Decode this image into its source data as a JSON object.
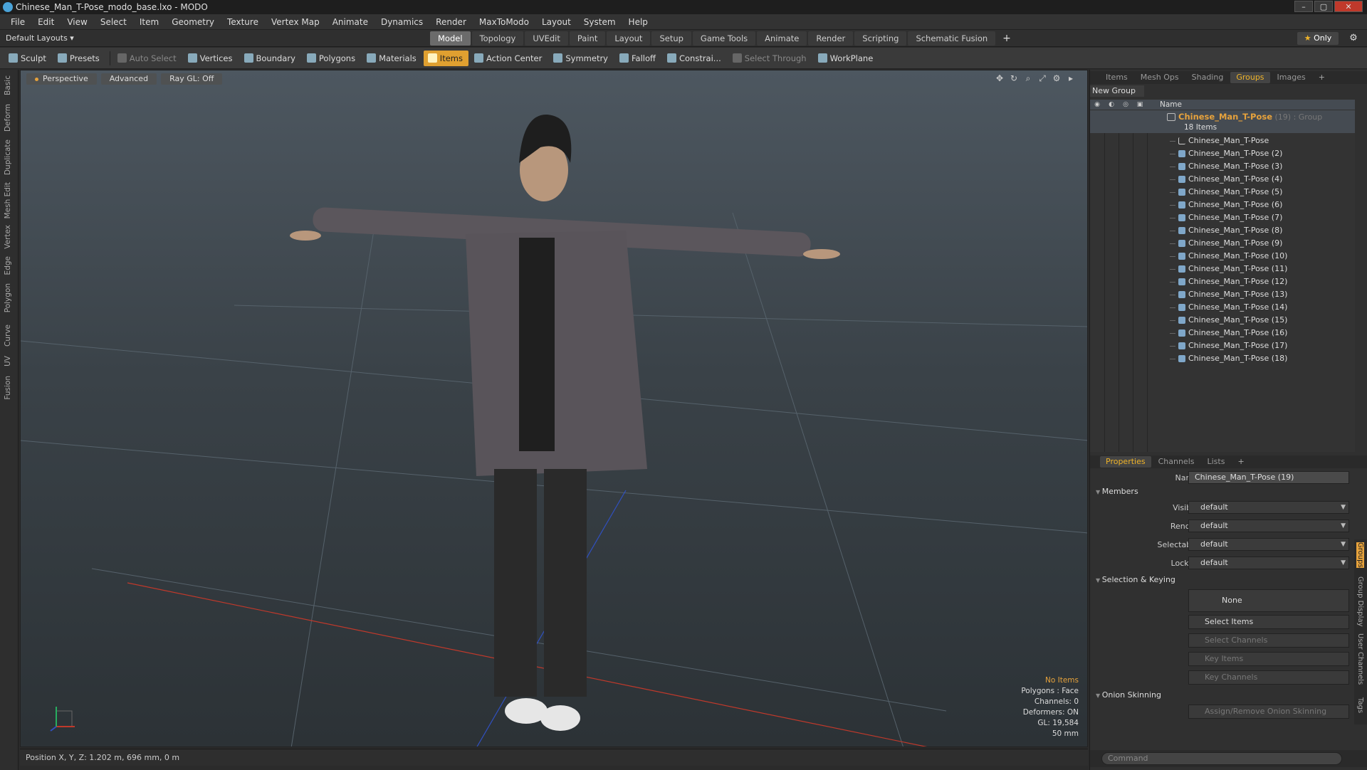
{
  "window": {
    "title": "Chinese_Man_T-Pose_modo_base.lxo - MODO",
    "minimize": "–",
    "maximize": "▢",
    "close": "✕"
  },
  "menu": [
    "File",
    "Edit",
    "View",
    "Select",
    "Item",
    "Geometry",
    "Texture",
    "Vertex Map",
    "Animate",
    "Dynamics",
    "Render",
    "MaxToModo",
    "Layout",
    "System",
    "Help"
  ],
  "layout": {
    "default_layouts": "Default Layouts ▾",
    "tabs": [
      "Model",
      "Topology",
      "UVEdit",
      "Paint",
      "Layout",
      "Setup",
      "Game Tools",
      "Animate",
      "Render",
      "Scripting",
      "Schematic Fusion"
    ],
    "active_tab": "Model",
    "plus": "+",
    "only": "Only"
  },
  "toolbar": {
    "sculpt": "Sculpt",
    "presets": "Presets",
    "auto_select": "Auto Select",
    "vertices": "Vertices",
    "boundary": "Boundary",
    "polygons": "Polygons",
    "materials": "Materials",
    "items": "Items",
    "action_center": "Action Center",
    "symmetry": "Symmetry",
    "falloff": "Falloff",
    "constrain": "Constrai...",
    "select_through": "Select Through",
    "workplane": "WorkPlane"
  },
  "left_tabs": [
    "Basic",
    "Deform",
    "Duplicate",
    "Mesh Edit",
    "Vertex",
    "Edge",
    "Polygon",
    "Curve",
    "UV",
    "Fusion"
  ],
  "viewport": {
    "perspective": "Perspective",
    "advanced": "Advanced",
    "raygl": "Ray GL: Off",
    "info": {
      "no_items": "No Items",
      "polygons": "Polygons : Face",
      "channels": "Channels: 0",
      "deformers": "Deformers: ON",
      "gl": "GL: 19,584",
      "lens": "50 mm"
    }
  },
  "status": {
    "position": "Position X, Y, Z:   1.202 m, 696 mm, 0 m"
  },
  "top_panel": {
    "tabs": [
      "Items",
      "Mesh Ops",
      "Shading",
      "Groups",
      "Images",
      "+"
    ],
    "active": "Groups",
    "new_group": "New Group",
    "name_col": "Name",
    "group": {
      "name": "Chinese_Man_T-Pose",
      "suffix": " (19) : Group",
      "count": "18 Items"
    },
    "items": [
      "Chinese_Man_T-Pose",
      "Chinese_Man_T-Pose (2)",
      "Chinese_Man_T-Pose (3)",
      "Chinese_Man_T-Pose (4)",
      "Chinese_Man_T-Pose (5)",
      "Chinese_Man_T-Pose (6)",
      "Chinese_Man_T-Pose (7)",
      "Chinese_Man_T-Pose (8)",
      "Chinese_Man_T-Pose (9)",
      "Chinese_Man_T-Pose (10)",
      "Chinese_Man_T-Pose (11)",
      "Chinese_Man_T-Pose (12)",
      "Chinese_Man_T-Pose (13)",
      "Chinese_Man_T-Pose (14)",
      "Chinese_Man_T-Pose (15)",
      "Chinese_Man_T-Pose (16)",
      "Chinese_Man_T-Pose (17)",
      "Chinese_Man_T-Pose (18)"
    ]
  },
  "properties": {
    "tabs": [
      "Properties",
      "Channels",
      "Lists",
      "+"
    ],
    "active": "Properties",
    "name_label": "Name",
    "name_value": "Chinese_Man_T-Pose (19)",
    "members": "Members",
    "visible_label": "Visible",
    "render_label": "Render",
    "selectable_label": "Selectable",
    "locked_label": "Locked",
    "default": "default",
    "selection_keying": "Selection & Keying",
    "none": "None",
    "select_items": "Select Items",
    "select_channels": "Select Channels",
    "key_items": "Key Items",
    "key_channels": "Key Channels",
    "onion": "Onion Skinning",
    "onion_btn": "Assign/Remove Onion Skinning",
    "side_tabs": [
      "Groups",
      "Group Display",
      "User Channels",
      "Tags"
    ]
  },
  "command": {
    "placeholder": "Command"
  }
}
